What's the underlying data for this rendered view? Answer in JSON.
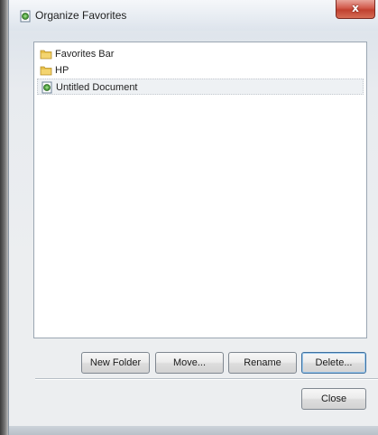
{
  "window": {
    "title": "Organize Favorites",
    "close_glyph": "x"
  },
  "list": {
    "items": [
      {
        "label": "Favorites Bar",
        "icon": "folder-icon",
        "selected": false
      },
      {
        "label": "HP",
        "icon": "folder-icon",
        "selected": false
      },
      {
        "label": "Untitled Document",
        "icon": "web-page-icon",
        "selected": true
      }
    ]
  },
  "buttons": {
    "new_folder": "New Folder",
    "move": "Move...",
    "rename": "Rename",
    "delete": "Delete...",
    "close": "Close"
  },
  "colors": {
    "folder": "#e8c14a",
    "close_button": "#c94a3a",
    "default_button_border": "#3d6f9e"
  }
}
